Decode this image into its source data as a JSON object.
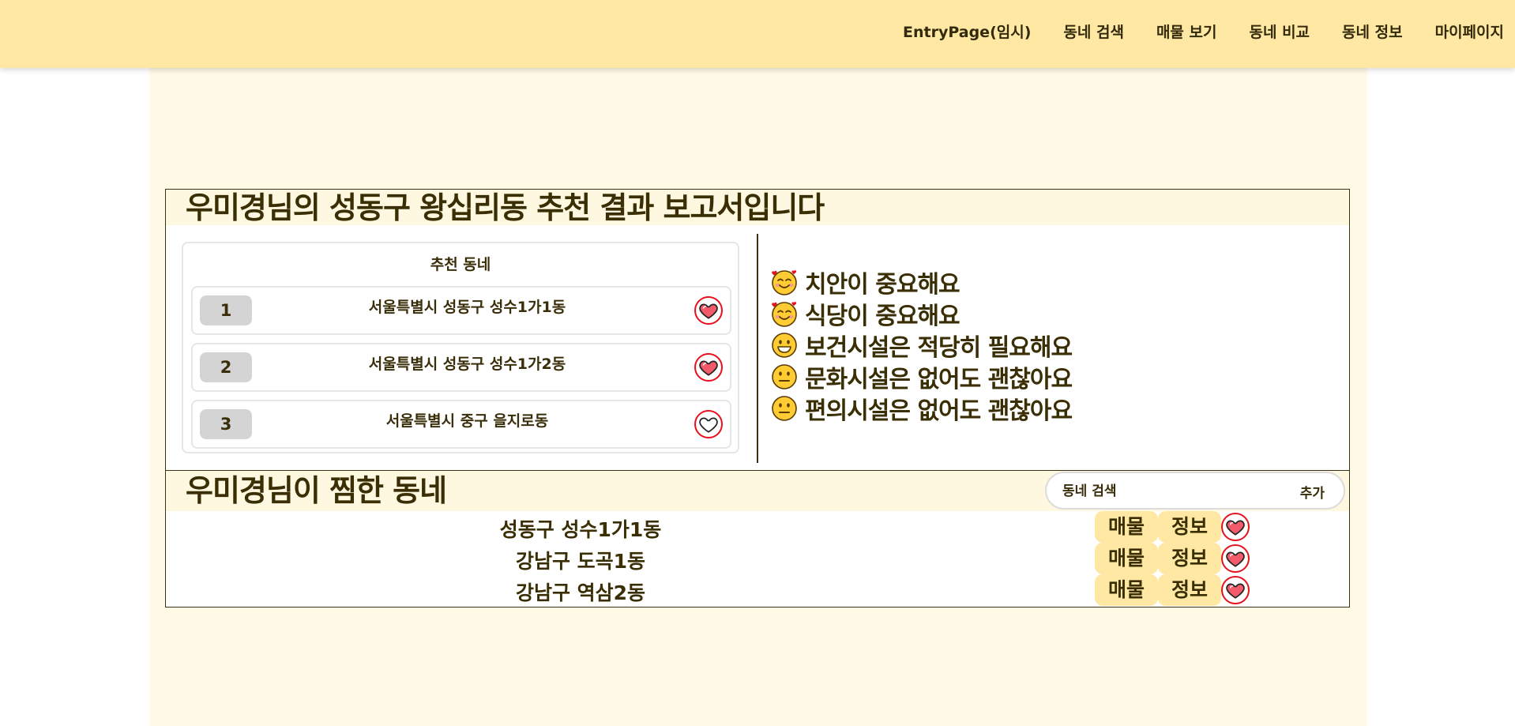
{
  "nav": {
    "items": [
      {
        "label": "EntryPage(임시)"
      },
      {
        "label": "동네 검색"
      },
      {
        "label": "매물 보기"
      },
      {
        "label": "동네 비교"
      },
      {
        "label": "동네 정보"
      },
      {
        "label": "마이페이지"
      }
    ]
  },
  "report": {
    "title": "우미경님의 성동구 왕십리동 추천 결과 보고서입니다",
    "recommend_heading": "추천 동네",
    "recommendations": [
      {
        "rank": "1",
        "name": "서울특별시 성동구 성수1가1동",
        "liked": true
      },
      {
        "rank": "2",
        "name": "서울특별시 성동구 성수1가2동",
        "liked": true
      },
      {
        "rank": "3",
        "name": "서울특별시 중구 을지로동",
        "liked": false
      }
    ],
    "preferences": [
      {
        "icon": "smiling-face-with-hearts-icon",
        "text": "치안이 중요해요"
      },
      {
        "icon": "smiling-face-with-hearts-icon",
        "text": "식당이 중요해요"
      },
      {
        "icon": "grinning-face-icon",
        "text": "보건시설은 적당히 필요해요"
      },
      {
        "icon": "neutral-face-icon",
        "text": "문화시설은 없어도 괜찮아요"
      },
      {
        "icon": "neutral-face-icon",
        "text": "편의시설은 없어도 괜찮아요"
      }
    ]
  },
  "favorites": {
    "title": "우미경님이 찜한 동네",
    "search_placeholder": "동네 검색",
    "add_label": "추가",
    "property_label": "매물",
    "info_label": "정보",
    "items": [
      {
        "name": "성동구 성수1가1동"
      },
      {
        "name": "강남구 도곡1동"
      },
      {
        "name": "강남구 역삼2동"
      }
    ]
  },
  "colors": {
    "nav_bg": "#ffe8a3",
    "page_bg": "#fffae6",
    "heart_red": "#e8101c",
    "heart_fill": "#f25a6a"
  }
}
